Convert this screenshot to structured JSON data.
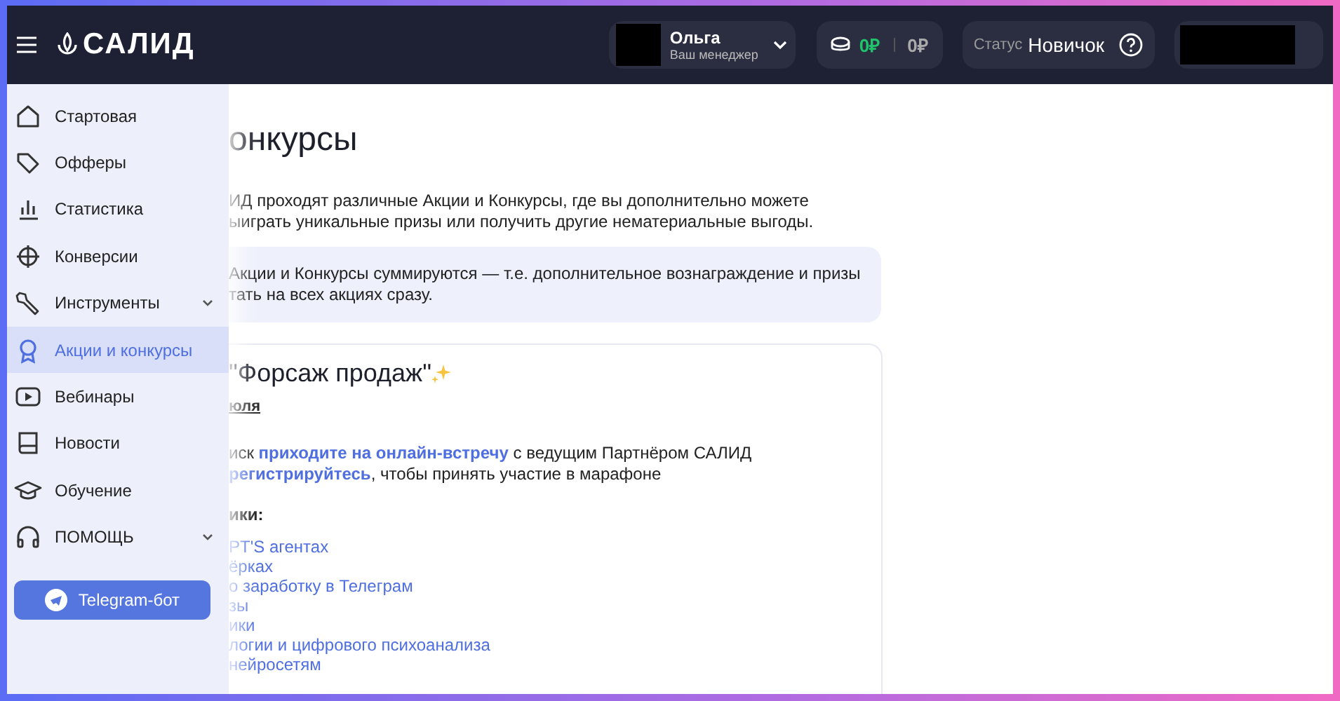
{
  "header": {
    "brand": "САЛИД",
    "manager": {
      "name": "Ольга",
      "role": "Ваш менеджер"
    },
    "balance": {
      "available": "0₽",
      "hold": "0₽"
    },
    "status": {
      "label": "Статус",
      "value": "Новичок"
    }
  },
  "sidebar": {
    "items": [
      {
        "label": "Стартовая",
        "selected": false,
        "submenu": false
      },
      {
        "label": "Офферы",
        "selected": false,
        "submenu": false
      },
      {
        "label": "Статистика",
        "selected": false,
        "submenu": false
      },
      {
        "label": "Конверсии",
        "selected": false,
        "submenu": false
      },
      {
        "label": "Инструменты",
        "selected": false,
        "submenu": true
      },
      {
        "label": "Акции и конкурсы",
        "selected": true,
        "submenu": false
      },
      {
        "label": "Вебинары",
        "selected": false,
        "submenu": false
      },
      {
        "label": "Новости",
        "selected": false,
        "submenu": false
      },
      {
        "label": "Обучение",
        "selected": false,
        "submenu": false
      },
      {
        "label": "ПОМОЩЬ",
        "selected": false,
        "submenu": true
      }
    ],
    "telegram_button": "Telegram-бот"
  },
  "content": {
    "title": "онкурсы",
    "intro": [
      "ИД проходят различные Акции и Конкурсы, где вы дополнительно можете",
      "ыиграть уникальные призы или получить другие нематериальные выгоды."
    ],
    "note": [
      "Акции и Конкурсы суммируются — т.е. дополнительное вознаграждение и призы",
      "тать на всех акциях сразу."
    ],
    "card": {
      "title": "\"Форсаж продаж\"",
      "date": "юля",
      "steps": [
        {
          "before": "иск ",
          "link": "приходите на онлайн-встречу",
          "after": " с ведущим Партнёром САЛИД"
        },
        {
          "link": "регистрируйтесь",
          "after": ", чтобы принять участие в марафоне"
        }
      ],
      "topics_label": "ики:",
      "topics": [
        "PT'S агентах",
        "ёрках",
        "о заработку в Телеграм",
        "зы",
        "ики",
        "логии и цифрового психоанализа",
        "нейросетям"
      ]
    }
  }
}
